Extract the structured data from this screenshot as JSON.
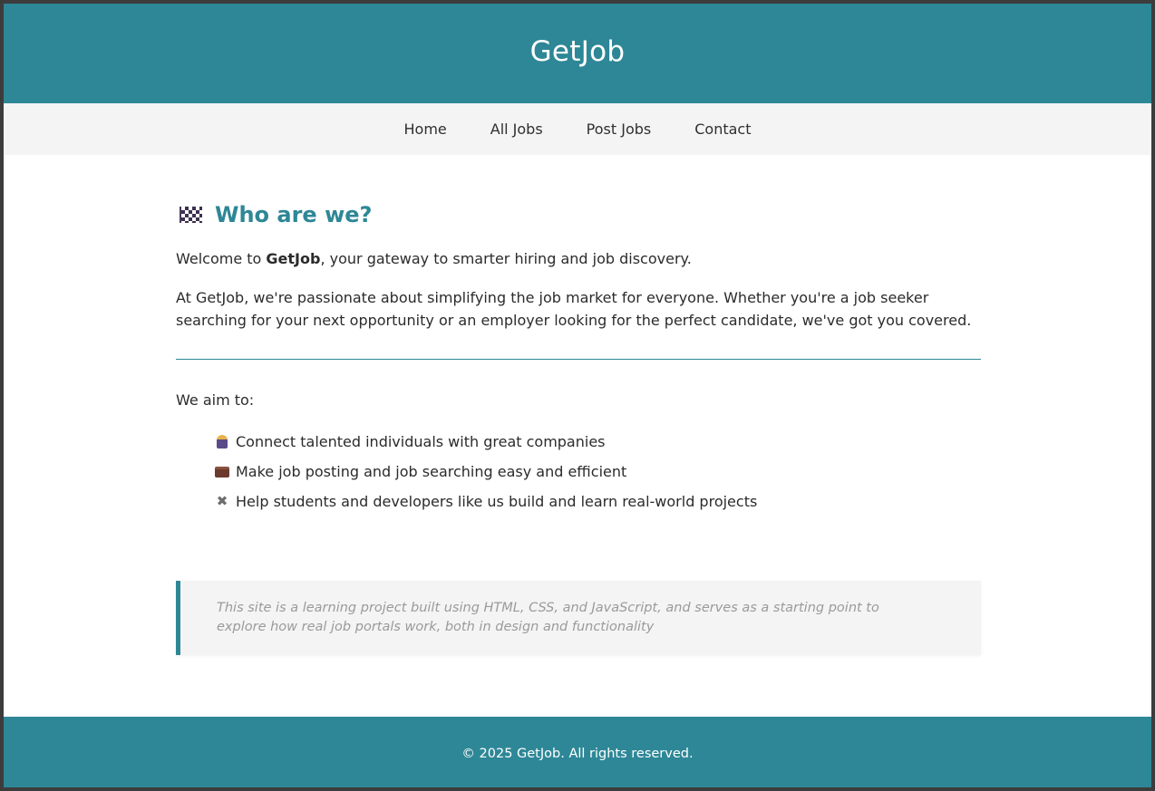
{
  "header": {
    "brand": "GetJob"
  },
  "nav": {
    "items": [
      {
        "label": "Home"
      },
      {
        "label": "All Jobs"
      },
      {
        "label": "Post Jobs"
      },
      {
        "label": "Contact"
      }
    ]
  },
  "about": {
    "heading_icon": "checkered-flag-icon",
    "heading": "Who are we?",
    "intro_prefix": "Welcome to ",
    "intro_brand": "GetJob",
    "intro_suffix": ", your gateway to smarter hiring and job discovery.",
    "body": "At GetJob, we're passionate about simplifying the job market for everyone. Whether you're a job seeker searching for your next opportunity or an employer looking for the perfect candidate, we've got you covered.",
    "aim_lead": "We aim to:",
    "aims": [
      {
        "icon": "worker-icon",
        "text": "Connect talented individuals with great companies"
      },
      {
        "icon": "briefcase-icon",
        "text": "Make job posting and job searching easy and efficient"
      },
      {
        "icon": "tools-icon",
        "text": "Help students and developers like us build and learn real-world projects"
      }
    ],
    "note": "This site is a learning project built using HTML, CSS, and JavaScript, and serves as a starting point to explore how real job portals work, both in design and functionality"
  },
  "footer": {
    "text": "© 2025 GetJob. All rights reserved."
  },
  "colors": {
    "brand": "#2e8796",
    "nav_bg": "#f4f4f4",
    "text": "#2b2b2b",
    "muted": "#9a9a9a"
  }
}
